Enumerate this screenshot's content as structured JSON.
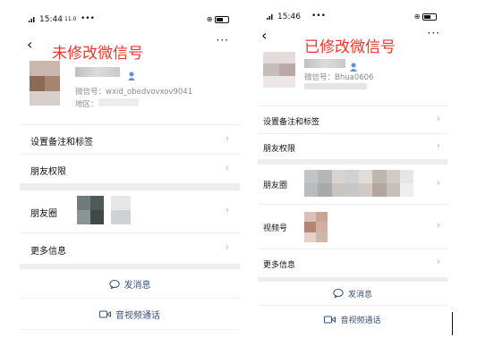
{
  "left": {
    "status": {
      "time": "15:44",
      "speed": "11.0\nKB/s",
      "icons": "•••"
    },
    "annotation": "未修改微信号",
    "profile": {
      "wechat_id": "微信号：wxid_obedvovxov9041",
      "region": "地区："
    },
    "rows": [
      {
        "label": "设置备注和标签"
      },
      {
        "label": "朋友权限"
      },
      {
        "label": "朋友圈"
      },
      {
        "label": "更多信息"
      }
    ],
    "actions": {
      "message": "发消息",
      "video_call": "音视频通话"
    }
  },
  "right": {
    "status": {
      "time": "15:46",
      "icons": "•••"
    },
    "annotation": "已修改微信号",
    "profile": {
      "wechat_id": "微信号：Bhua0606"
    },
    "rows": [
      {
        "label": "设置备注和标签"
      },
      {
        "label": "朋友权限"
      },
      {
        "label": "朋友圈"
      },
      {
        "label": "视频号"
      },
      {
        "label": "更多信息"
      }
    ],
    "actions": {
      "message": "发消息",
      "video_call": "音视频通话"
    }
  },
  "colors": {
    "annotation_red": "#e8372c",
    "action_blue": "#3a4f79",
    "chevron_gray": "#b3b3b3",
    "separator": "#ededed"
  },
  "icons": [
    "back-arrow-icon",
    "more-dots-icon",
    "person-icon",
    "chevron-right-icon",
    "chat-bubble-icon",
    "video-call-icon",
    "battery-icon",
    "signal-icon"
  ]
}
